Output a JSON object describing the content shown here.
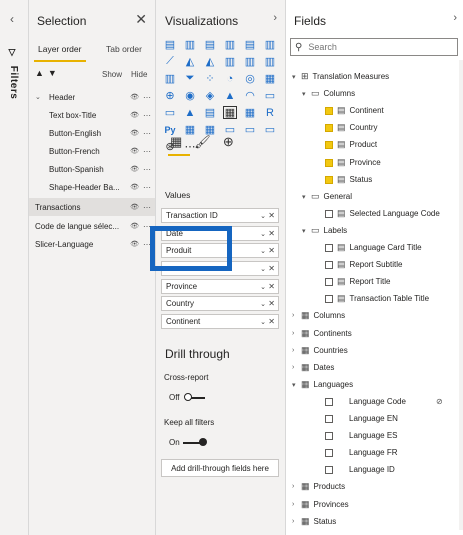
{
  "filters_rail": {
    "label": "Filters",
    "collapse_icon": "chevron-left-icon"
  },
  "selection": {
    "title": "Selection",
    "tabs": [
      "Layer order",
      "Tab order"
    ],
    "show_label": "Show",
    "hide_label": "Hide",
    "items": [
      {
        "label": "Header",
        "group": true,
        "active": false
      },
      {
        "label": "Text box-Title",
        "group": false,
        "active": false
      },
      {
        "label": "Button-English",
        "group": false,
        "active": false
      },
      {
        "label": "Button-French",
        "group": false,
        "active": false
      },
      {
        "label": "Button-Spanish",
        "group": false,
        "active": false
      },
      {
        "label": "Shape-Header Ba...",
        "group": false,
        "active": false
      },
      {
        "label": "Transactions",
        "group": false,
        "active": true,
        "top": true
      },
      {
        "label": "Code de langue sélec...",
        "group": false,
        "active": false,
        "top": true
      },
      {
        "label": "Slicer-Language",
        "group": false,
        "active": false,
        "top": true
      }
    ]
  },
  "visualizations": {
    "title": "Visualizations",
    "values_label": "Values",
    "wells": [
      "Transaction ID",
      "Date",
      "Produit",
      "",
      "Province",
      "Country",
      "Continent"
    ],
    "drill_title": "Drill through",
    "cross_report_label": "Cross-report",
    "cross_report_state": "Off",
    "keep_filters_label": "Keep all filters",
    "keep_filters_state": "On",
    "drill_button": "Add drill-through fields here",
    "icon_names": [
      "stacked-bar-icon",
      "stacked-column-icon",
      "clustered-bar-icon",
      "clustered-column-icon",
      "100-bar-icon",
      "100-column-icon",
      "line-chart-icon",
      "area-chart-icon",
      "stacked-area-icon",
      "line-column-icon",
      "line-clustered-icon",
      "ribbon-icon",
      "waterfall-icon",
      "funnel-icon",
      "scatter-icon",
      "pie-icon",
      "donut-icon",
      "treemap-icon",
      "map-icon",
      "filled-map-icon",
      "shape-map-icon",
      "azure-map-icon",
      "gauge-icon",
      "card-icon",
      "multi-card-icon",
      "kpi-icon",
      "slicer-icon",
      "table-icon",
      "matrix-icon",
      "r-visual-icon",
      "python-icon",
      "key-influencers-icon",
      "decomposition-icon",
      "qa-icon",
      "smart-narrative-icon",
      "paginated-icon",
      "arcgis-icon",
      "more-icon"
    ]
  },
  "fields": {
    "title": "Fields",
    "search_placeholder": "Search",
    "rows": [
      {
        "label": "Translation Measures",
        "indent": 0,
        "toggle": "▾",
        "icon": "⊞",
        "check": false,
        "checked": false
      },
      {
        "label": "Columns",
        "indent": 1,
        "toggle": "▾",
        "icon": "▭",
        "check": false,
        "checked": false
      },
      {
        "label": "Continent",
        "indent": 2,
        "toggle": "",
        "icon": "▤",
        "check": true,
        "checked": true
      },
      {
        "label": "Country",
        "indent": 2,
        "toggle": "",
        "icon": "▤",
        "check": true,
        "checked": true
      },
      {
        "label": "Product",
        "indent": 2,
        "toggle": "",
        "icon": "▤",
        "check": true,
        "checked": true
      },
      {
        "label": "Province",
        "indent": 2,
        "toggle": "",
        "icon": "▤",
        "check": true,
        "checked": true
      },
      {
        "label": "Status",
        "indent": 2,
        "toggle": "",
        "icon": "▤",
        "check": true,
        "checked": true
      },
      {
        "label": "General",
        "indent": 1,
        "toggle": "▾",
        "icon": "▭",
        "check": false,
        "checked": false
      },
      {
        "label": "Selected Language Code",
        "indent": 2,
        "toggle": "",
        "icon": "▤",
        "check": true,
        "checked": false
      },
      {
        "label": "Labels",
        "indent": 1,
        "toggle": "▾",
        "icon": "▭",
        "check": false,
        "checked": false
      },
      {
        "label": "Language Card Title",
        "indent": 2,
        "toggle": "",
        "icon": "▤",
        "check": true,
        "checked": false
      },
      {
        "label": "Report Subtitle",
        "indent": 2,
        "toggle": "",
        "icon": "▤",
        "check": true,
        "checked": false
      },
      {
        "label": "Report Title",
        "indent": 2,
        "toggle": "",
        "icon": "▤",
        "check": true,
        "checked": false
      },
      {
        "label": "Transaction Table Title",
        "indent": 2,
        "toggle": "",
        "icon": "▤",
        "check": true,
        "checked": false
      },
      {
        "label": "Columns",
        "indent": 0,
        "toggle": "›",
        "icon": "▦",
        "check": false,
        "checked": false
      },
      {
        "label": "Continents",
        "indent": 0,
        "toggle": "›",
        "icon": "▦",
        "check": false,
        "checked": false
      },
      {
        "label": "Countries",
        "indent": 0,
        "toggle": "›",
        "icon": "▦",
        "check": false,
        "checked": false
      },
      {
        "label": "Dates",
        "indent": 0,
        "toggle": "›",
        "icon": "▦",
        "check": false,
        "checked": false
      },
      {
        "label": "Languages",
        "indent": 0,
        "toggle": "▾",
        "icon": "▦",
        "check": false,
        "checked": false
      },
      {
        "label": "Language Code",
        "indent": 2,
        "toggle": "",
        "icon": "",
        "check": true,
        "checked": false,
        "hidden_icon": true
      },
      {
        "label": "Language EN",
        "indent": 2,
        "toggle": "",
        "icon": "",
        "check": true,
        "checked": false
      },
      {
        "label": "Language ES",
        "indent": 2,
        "toggle": "",
        "icon": "",
        "check": true,
        "checked": false
      },
      {
        "label": "Language FR",
        "indent": 2,
        "toggle": "",
        "icon": "",
        "check": true,
        "checked": false
      },
      {
        "label": "Language ID",
        "indent": 2,
        "toggle": "",
        "icon": "",
        "check": true,
        "checked": false
      },
      {
        "label": "Products",
        "indent": 0,
        "toggle": "›",
        "icon": "▦",
        "check": false,
        "checked": false
      },
      {
        "label": "Provinces",
        "indent": 0,
        "toggle": "›",
        "icon": "▦",
        "check": false,
        "checked": false
      },
      {
        "label": "Status",
        "indent": 0,
        "toggle": "›",
        "icon": "▦",
        "check": false,
        "checked": false
      }
    ]
  },
  "colors": {
    "accent": "#e8b200",
    "highlight_box": "#1565c0",
    "pane_bg": "#f3f2f1"
  }
}
